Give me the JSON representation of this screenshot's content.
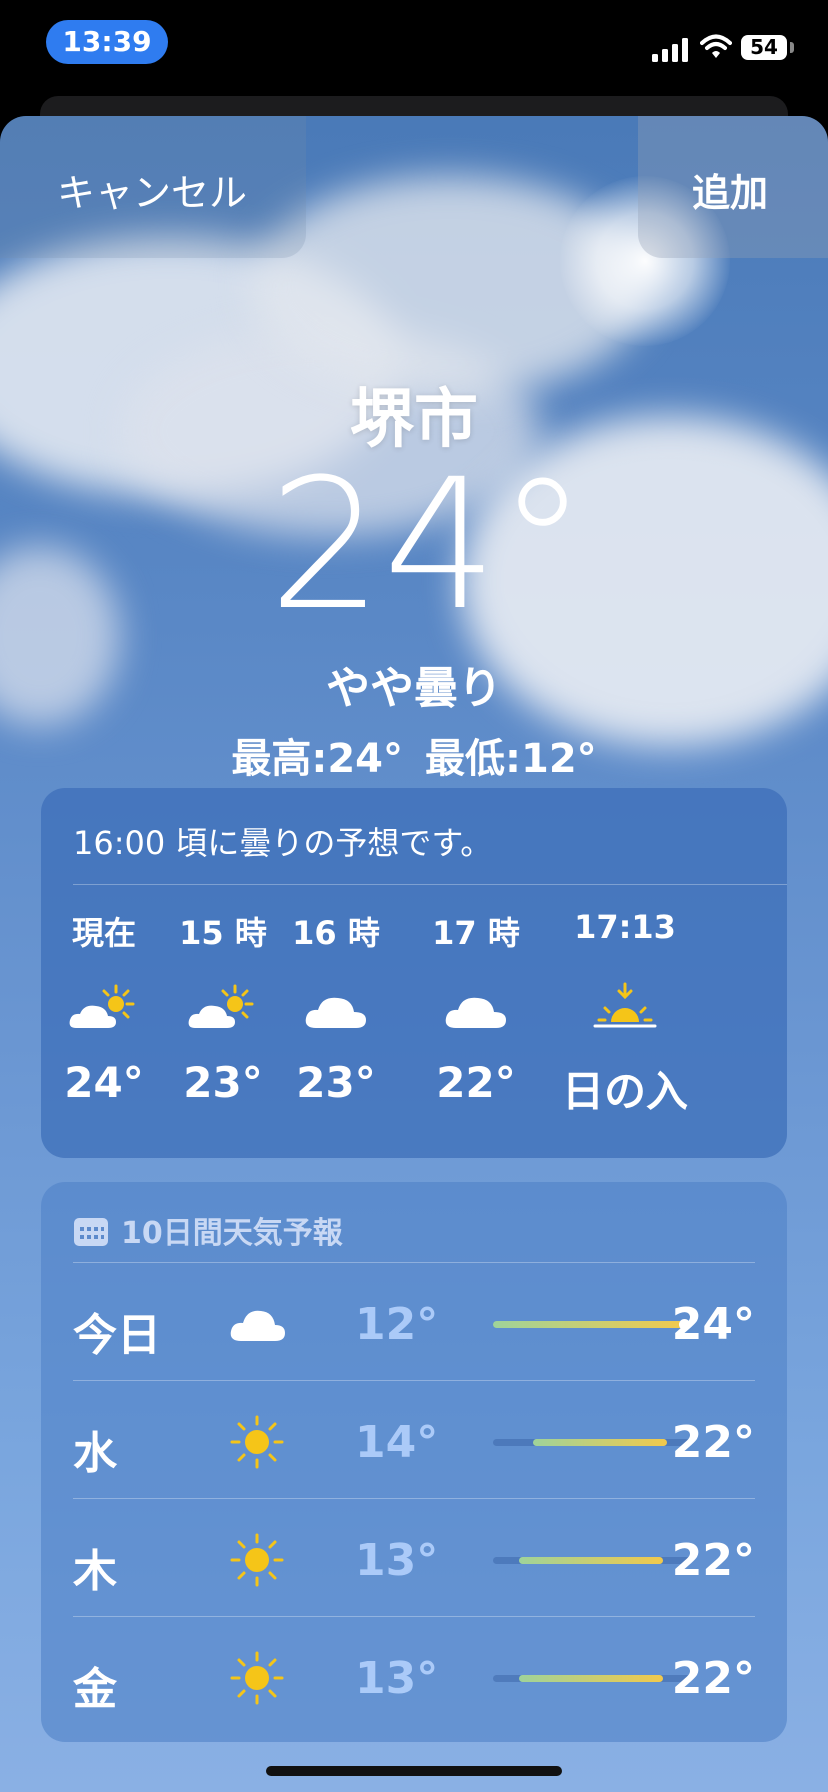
{
  "status": {
    "time": "13:39",
    "battery": "54"
  },
  "nav": {
    "cancel": "キャンセル",
    "add": "追加"
  },
  "current": {
    "city": "堺市",
    "temp": "24°",
    "condition": "やや曇り",
    "high": "最高:24°",
    "low": "最低:12°"
  },
  "hourly": {
    "summary": "16:00 頃に曇りの予想です。",
    "items": [
      {
        "label": "現在",
        "icon": "partly-cloudy-icon",
        "temp": "24°"
      },
      {
        "label": "15 時",
        "icon": "partly-cloudy-icon",
        "temp": "23°"
      },
      {
        "label": "16 時",
        "icon": "cloud-icon",
        "temp": "23°"
      },
      {
        "label": "17 時",
        "icon": "cloud-icon",
        "temp": "22°"
      },
      {
        "label": "17:13",
        "icon": "sunset-icon",
        "temp": "日の入"
      }
    ]
  },
  "daily": {
    "header": "10日間天気予報",
    "days": [
      {
        "name": "今日",
        "icon": "cloud-icon",
        "low": "12°",
        "high": "24°",
        "range_start": 0.0,
        "range_end": 0.97,
        "current_marker": 0.97
      },
      {
        "name": "水",
        "icon": "sun-icon",
        "low": "14°",
        "high": "22°",
        "range_start": 0.2,
        "range_end": 0.88
      },
      {
        "name": "木",
        "icon": "sun-icon",
        "low": "13°",
        "high": "22°",
        "range_start": 0.13,
        "range_end": 0.86
      },
      {
        "name": "金",
        "icon": "sun-icon",
        "low": "13°",
        "high": "22°",
        "range_start": 0.13,
        "range_end": 0.86
      }
    ]
  },
  "colors": {
    "status_pill": "#2f7cf0",
    "sun": "#f5c518",
    "range_low": "#9fd39a",
    "range_high": "#f2c94c"
  }
}
